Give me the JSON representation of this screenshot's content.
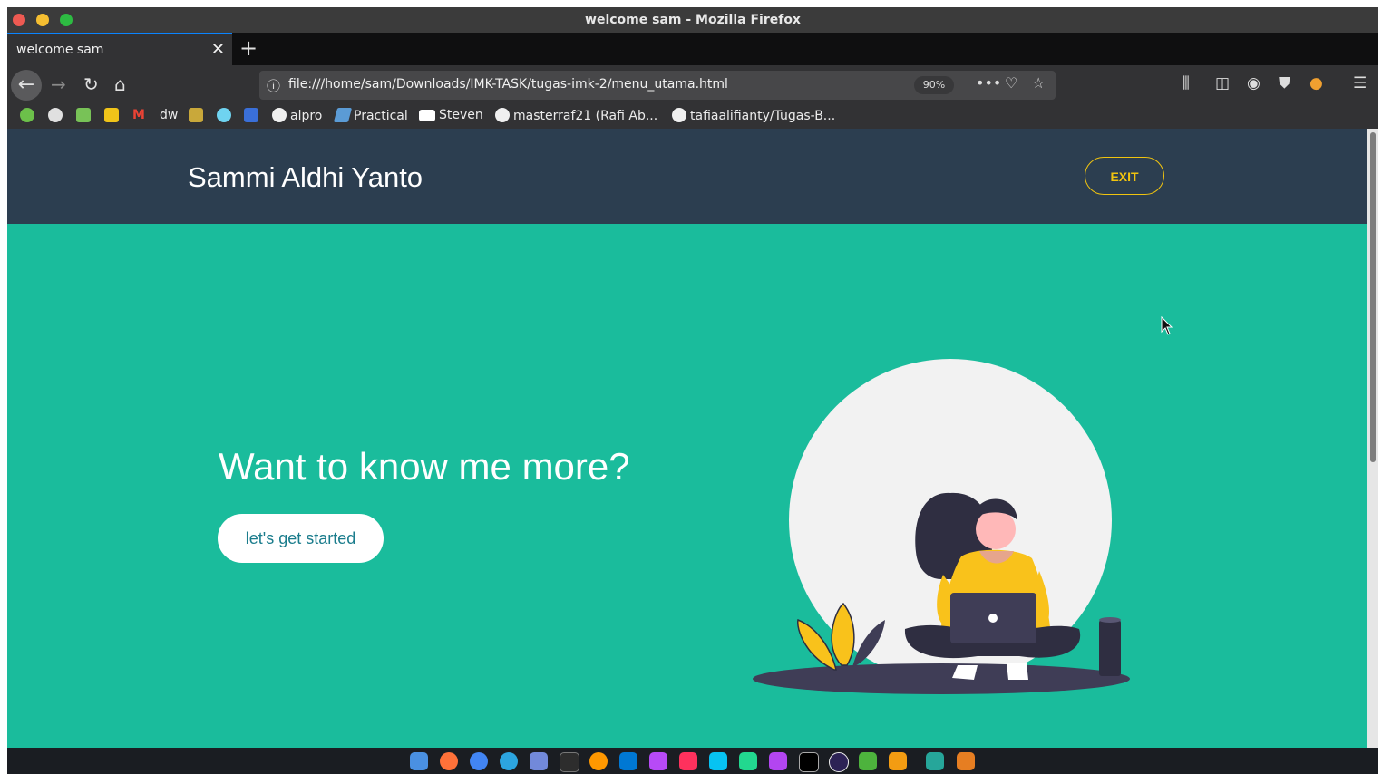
{
  "window": {
    "title": "welcome sam - Mozilla Firefox"
  },
  "tab": {
    "label": "welcome sam",
    "close": "✕",
    "new": "+"
  },
  "navbar": {
    "url": "file:///home/sam/Downloads/IMK-TASK/tugas-imk-2/menu_utama.html",
    "zoom": "90%"
  },
  "bookmarks": [
    {
      "label": "alpro",
      "icon": "github-icon"
    },
    {
      "label": "Practical",
      "icon": "feather-icon"
    },
    {
      "label": "Steven",
      "icon": "dev-icon"
    },
    {
      "label": "masterraf21 (Rafi Ab...",
      "icon": "github-icon"
    },
    {
      "label": "tafiaalifianty/Tugas-B...",
      "icon": "github-icon"
    }
  ],
  "bookmark_icons": [
    "leaf-icon",
    "github-icon",
    "android-icon",
    "image-icon",
    "gmail-icon",
    "dw-icon",
    "question-icon",
    "hex-icon",
    "infinity-icon"
  ],
  "page": {
    "brand": "Sammi Aldhi Yanto",
    "exit": "EXIT",
    "heading": "Want to know me more?",
    "cta": "let's get started"
  },
  "colors": {
    "header_bg": "#2c3e50",
    "hero_bg": "#1abc9c",
    "accent": "#f1c40f",
    "cta_text": "#1a7c8c"
  },
  "dock_icons": [
    "finder-icon",
    "firefox-icon",
    "chromium-icon",
    "telegram-icon",
    "discord-icon",
    "terminal-icon",
    "sublime-icon",
    "vscode-icon",
    "goland-icon",
    "intellij-icon",
    "webstorm-icon",
    "datagrip-icon",
    "phpstorm-icon",
    "jetbrains-toolbox-icon",
    "eclipse-icon",
    "mongodb-icon",
    "postman-icon",
    "files-icon",
    "editor-icon"
  ]
}
